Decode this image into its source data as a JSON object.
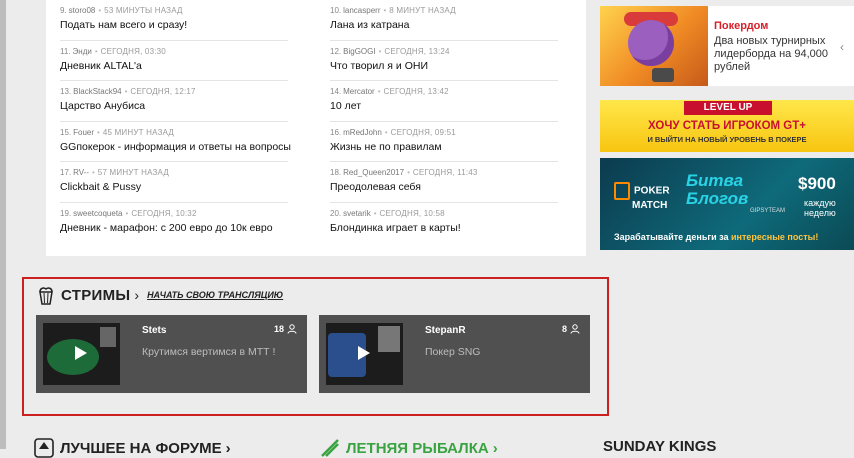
{
  "blogs": {
    "left": [
      {
        "num": "9.",
        "author": "storo08",
        "time": "53 минуты назад",
        "title": "Подать нам всего и сразу!"
      },
      {
        "num": "11.",
        "author": "Энди",
        "time": "сегодня, 03:30",
        "title": "Дневник ALTAL'a"
      },
      {
        "num": "13.",
        "author": "BlackStack94",
        "time": "сегодня, 12:17",
        "title": "Царство Анубиса"
      },
      {
        "num": "15.",
        "author": "Fouer",
        "time": "45 минут назад",
        "title": "GGпокерок - информация и ответы на вопросы"
      },
      {
        "num": "17.",
        "author": "RV--",
        "time": "57 минут назад",
        "title": "Clickbait & Pussy"
      },
      {
        "num": "19.",
        "author": "sweetcoqueta",
        "time": "сегодня, 10:32",
        "title": "Дневник - марафон: с 200 евро до 10к евро"
      }
    ],
    "right": [
      {
        "num": "10.",
        "author": "lancasperr",
        "time": "8 минут назад",
        "title": "Лана из катрана"
      },
      {
        "num": "12.",
        "author": "BigGOGI",
        "time": "сегодня, 13:24",
        "title": "Что творил я и ОНИ"
      },
      {
        "num": "14.",
        "author": "Mercator",
        "time": "сегодня, 13:42",
        "title": "10 лет"
      },
      {
        "num": "16.",
        "author": "mRedJohn",
        "time": "сегодня, 09:51",
        "title": "Жизнь не по правилам"
      },
      {
        "num": "18.",
        "author": "Red_Queen2017",
        "time": "сегодня, 11:43",
        "title": "Преодолевая себя"
      },
      {
        "num": "20.",
        "author": "svetarik",
        "time": "сегодня, 10:58",
        "title": "Блондинка играет в карты!"
      }
    ]
  },
  "ads": {
    "pokerdom": {
      "heading": "Покердом",
      "text": "Два новых турнирных лидерборда на 94,000 рублей",
      "close": "‹"
    },
    "levelup": {
      "ribbon": "LEVEL UP",
      "headline": "ХОЧУ СТАТЬ ИГРОКОМ GT+",
      "subline": "И ВЫЙТИ НА НОВЫЙ УРОВЕНЬ В ПОКЕРЕ"
    },
    "battle": {
      "logo_line1": "POKER",
      "logo_line2": "MATCH",
      "title_line1": "Битва",
      "title_line2": "Блогов",
      "gypsy": "GIPSYTEAM",
      "amount": "$900",
      "weekly_line1": "каждую",
      "weekly_line2": "неделю",
      "bottom_prefix": "Зарабатывайте деньги за ",
      "bottom_highlight": "интересные посты!"
    }
  },
  "streams": {
    "title": "СТРИМЫ",
    "chevron": "›",
    "start_link": "Начать свою трансляцию",
    "items": [
      {
        "name": "Stets",
        "viewers": "18",
        "description": "Крутимся вертимся в МТТ !"
      },
      {
        "name": "StepanR",
        "viewers": "8",
        "description": "Покер SNG"
      }
    ]
  },
  "bottom_headers": {
    "forum": "ЛУЧШЕЕ НА ФОРУМЕ",
    "fishing": "ЛЕТНЯЯ РЫБАЛКА",
    "sunday": "SUNDAY KINGS",
    "arrow": "›"
  },
  "colors": {
    "accent_red": "#cc1f1f",
    "stream_card": "#505050",
    "fishing_green": "#3aa341",
    "pokerdom_red": "#d8202a"
  }
}
